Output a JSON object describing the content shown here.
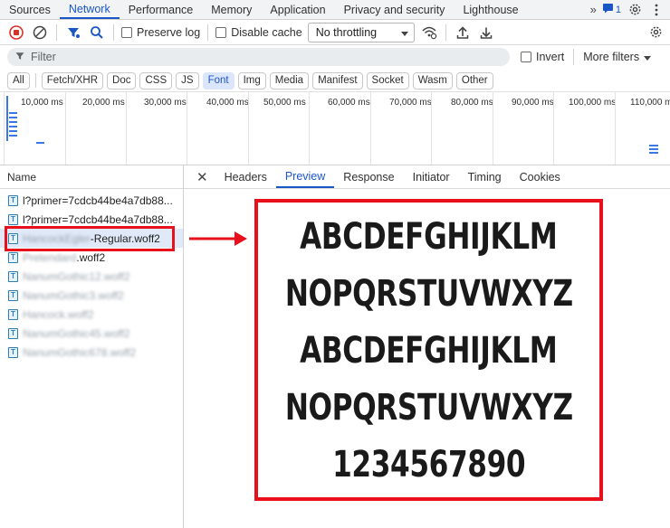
{
  "tabbar": {
    "tabs": [
      "Sources",
      "Network",
      "Performance",
      "Memory",
      "Application",
      "Privacy and security",
      "Lighthouse"
    ],
    "active": "Network",
    "overflow_icon": "double-chevron-right-icon",
    "message_count": "1"
  },
  "toolbar": {
    "preserve_log": "Preserve log",
    "disable_cache": "Disable cache",
    "throttling": "No throttling"
  },
  "filter": {
    "placeholder": "Filter",
    "invert": "Invert",
    "more_filters": "More filters"
  },
  "type_filters": [
    "All",
    "Fetch/XHR",
    "Doc",
    "CSS",
    "JS",
    "Font",
    "Img",
    "Media",
    "Manifest",
    "Socket",
    "Wasm",
    "Other"
  ],
  "active_type": "Font",
  "timeline": {
    "ticks": [
      "10,000 ms",
      "20,000 ms",
      "30,000 ms",
      "40,000 ms",
      "50,000 ms",
      "60,000 ms",
      "70,000 ms",
      "80,000 ms",
      "90,000 ms",
      "100,000 ms",
      "110,000 ms"
    ]
  },
  "requests": {
    "header": "Name",
    "rows": [
      {
        "prefix": "",
        "name": "l?primer=7cdcb44be4a7db88..."
      },
      {
        "prefix": "",
        "name": "l?primer=7cdcb44be4a7db88..."
      },
      {
        "prefix": "HancockEgler",
        "name": "-Regular.woff2"
      },
      {
        "prefix": "Pretendard",
        "name": ".woff2"
      },
      {
        "prefix": "NanumGothic12.woff2",
        "name": ""
      },
      {
        "prefix": "NanumGothic3.woff2",
        "name": ""
      },
      {
        "prefix": "Hancock.woff2",
        "name": ""
      },
      {
        "prefix": "NanumGothic45.woff2",
        "name": ""
      },
      {
        "prefix": "NanumGothic678.woff2",
        "name": ""
      }
    ]
  },
  "detail": {
    "tabs": [
      "Headers",
      "Preview",
      "Response",
      "Initiator",
      "Timing",
      "Cookies"
    ],
    "active": "Preview",
    "preview_lines": [
      "ABCDEFGHIJKLM",
      "NOPQRSTUVWXYZ",
      "ABCDEFGHIJKLM",
      "NOPQRSTUVWXYZ",
      "1234567890"
    ]
  },
  "accent": "#e8111b",
  "link_blue": "#1a56c6"
}
